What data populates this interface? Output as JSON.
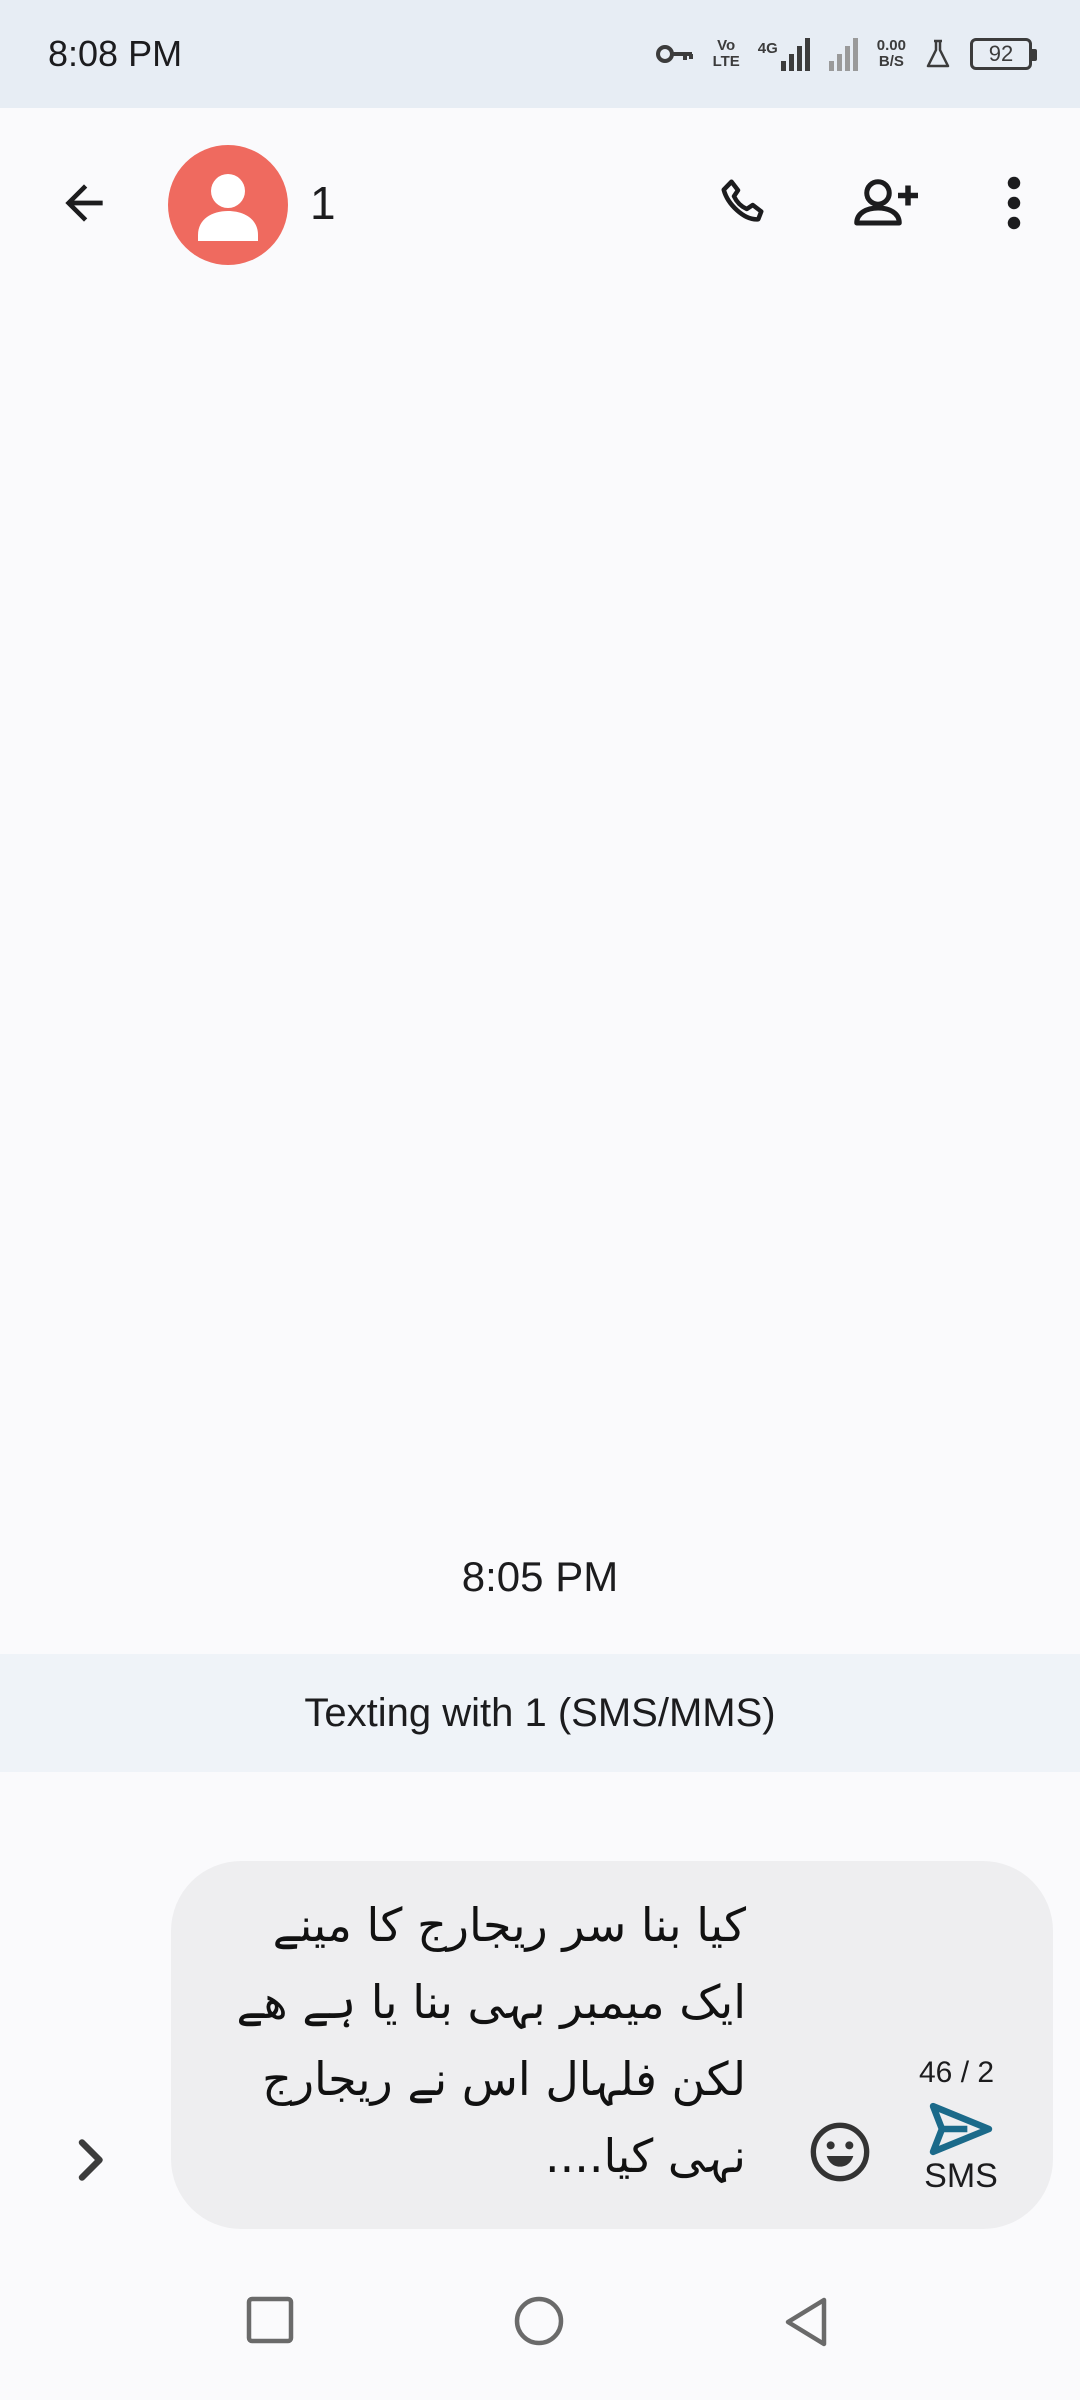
{
  "status_bar": {
    "time": "8:08 PM",
    "volte_top": "Vo",
    "volte_bottom": "LTE",
    "network_type": "4G",
    "data_speed": "0.00",
    "data_unit": "B/S",
    "battery_level": "92",
    "icons": [
      "vpn-key-icon",
      "volte-icon",
      "signal-4g-icon",
      "signal-icon",
      "data-speed-icon",
      "flask-icon",
      "battery-icon"
    ]
  },
  "app_bar": {
    "contact_name": "1",
    "icons": [
      "back-arrow-icon",
      "avatar-person-icon",
      "phone-icon",
      "add-person-icon",
      "more-vert-icon"
    ]
  },
  "conversation": {
    "timestamp": "8:05 PM",
    "texting_banner": "Texting with 1 (SMS/MMS)"
  },
  "compose": {
    "message_text": "کیا بنا سر ریجارج کا مینے ایک میمبر بہی بنا یا ہے ھے لکن فلہال اس نے ریجارج نہی کیا....",
    "char_count": "46 / 2",
    "send_label": "SMS",
    "icons": [
      "chevron-right-icon",
      "emoji-icon",
      "send-icon"
    ]
  },
  "colors": {
    "avatar": "#ef6a5f",
    "send": "#1b6a8a",
    "status_bar_bg": "#e7edf4",
    "banner_bg": "#eff3f8",
    "compose_bg": "#eeeef0"
  }
}
